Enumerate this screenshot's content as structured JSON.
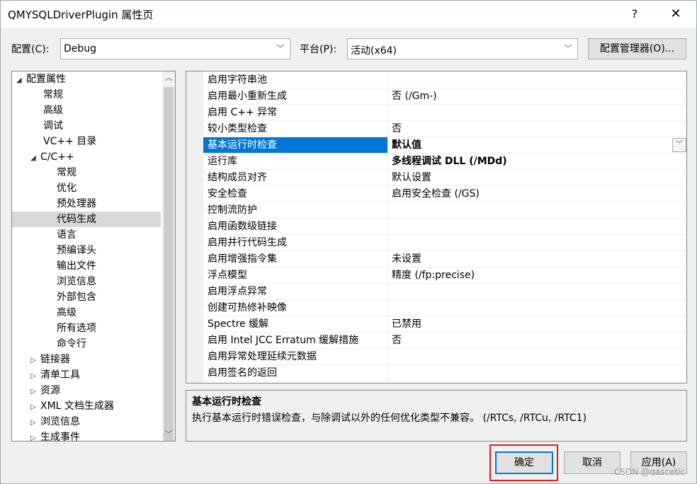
{
  "window": {
    "title": "QMYSQLDriverPlugin 属性页",
    "help": "?",
    "close": "✕"
  },
  "config": {
    "label": "配置(C):",
    "value": "Debug"
  },
  "platform": {
    "label": "平台(P):",
    "value": "活动(x64)"
  },
  "config_manager_label": "配置管理器(O)...",
  "tree": [
    {
      "label": "配置属性",
      "arrow": "◢"
    },
    {
      "label": "常规",
      "arrow": ""
    },
    {
      "label": "高级",
      "arrow": ""
    },
    {
      "label": "调试",
      "arrow": ""
    },
    {
      "label": "VC++ 目录",
      "arrow": ""
    },
    {
      "label": "C/C++",
      "arrow": "◢"
    },
    {
      "label": "常规",
      "arrow": ""
    },
    {
      "label": "优化",
      "arrow": ""
    },
    {
      "label": "预处理器",
      "arrow": ""
    },
    {
      "label": "代码生成",
      "arrow": ""
    },
    {
      "label": "语言",
      "arrow": ""
    },
    {
      "label": "预编译头",
      "arrow": ""
    },
    {
      "label": "输出文件",
      "arrow": ""
    },
    {
      "label": "浏览信息",
      "arrow": ""
    },
    {
      "label": "外部包含",
      "arrow": ""
    },
    {
      "label": "高级",
      "arrow": ""
    },
    {
      "label": "所有选项",
      "arrow": ""
    },
    {
      "label": "命令行",
      "arrow": ""
    },
    {
      "label": "链接器",
      "arrow": "▷"
    },
    {
      "label": "清单工具",
      "arrow": "▷"
    },
    {
      "label": "资源",
      "arrow": "▷"
    },
    {
      "label": "XML 文档生成器",
      "arrow": "▷"
    },
    {
      "label": "浏览信息",
      "arrow": "▷"
    },
    {
      "label": "生成事件",
      "arrow": "▷"
    }
  ],
  "properties": [
    {
      "name": "启用字符串池",
      "value": ""
    },
    {
      "name": "启用最小重新生成",
      "value": "否 (/Gm-)"
    },
    {
      "name": "启用 C++ 异常",
      "value": ""
    },
    {
      "name": "较小类型检查",
      "value": "否"
    },
    {
      "name": "基本运行时检查",
      "value": "默认值"
    },
    {
      "name": "运行库",
      "value": "多线程调试 DLL (/MDd)"
    },
    {
      "name": "结构成员对齐",
      "value": "默认设置"
    },
    {
      "name": "安全检查",
      "value": "启用安全检查 (/GS)"
    },
    {
      "name": "控制流防护",
      "value": ""
    },
    {
      "name": "启用函数级链接",
      "value": ""
    },
    {
      "name": "启用并行代码生成",
      "value": ""
    },
    {
      "name": "启用增强指令集",
      "value": "未设置"
    },
    {
      "name": "浮点模型",
      "value": "精度 (/fp:precise)"
    },
    {
      "name": "启用浮点异常",
      "value": ""
    },
    {
      "name": "创建可热修补映像",
      "value": ""
    },
    {
      "name": "Spectre 缓解",
      "value": "已禁用"
    },
    {
      "name": "启用 Intel JCC Erratum 缓解措施",
      "value": "否"
    },
    {
      "name": "启用异常处理延续元数据",
      "value": ""
    },
    {
      "name": "启用签名的返回",
      "value": ""
    }
  ],
  "description": {
    "title": "基本运行时检查",
    "text": "执行基本运行时错误检查，与除调试以外的任何优化类型不兼容。    (/RTCs, /RTCu, /RTC1)"
  },
  "buttons": {
    "ok": "确定",
    "cancel": "取消",
    "apply": "应用(A)"
  },
  "watermark": "CSDN @qascetic",
  "colors": {
    "selection": "#0078d7",
    "highlight_box": "#e02020"
  }
}
